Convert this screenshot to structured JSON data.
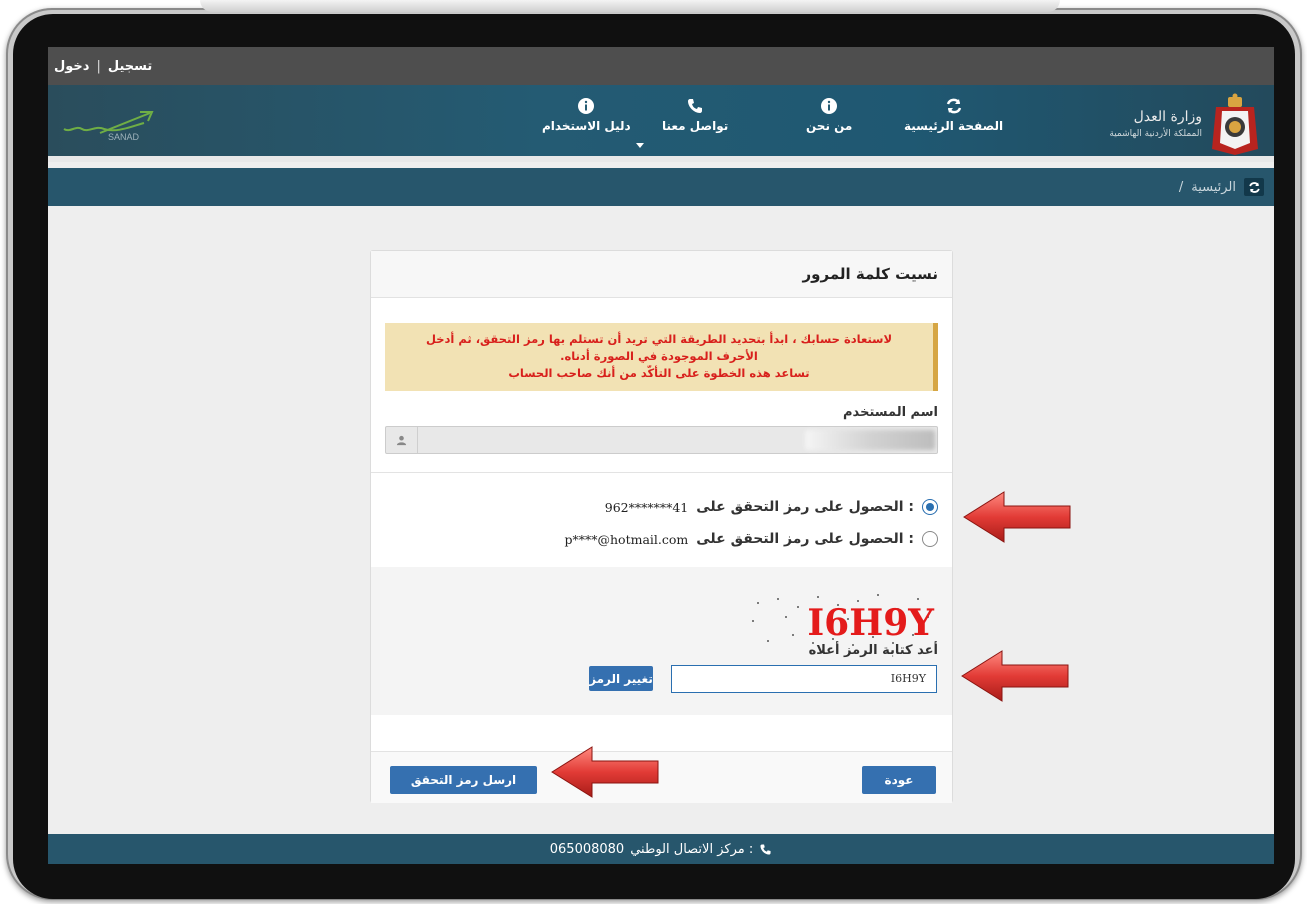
{
  "topbar": {
    "login": "دخول",
    "separator": "|",
    "register": "تسجيل"
  },
  "header": {
    "logo_text": "SANAD",
    "nav": [
      {
        "label": "دليل الاستخدام",
        "icon": "info-icon"
      },
      {
        "label": "تواصل معنا",
        "icon": "phone-icon"
      },
      {
        "label": "من نحن",
        "icon": "info-icon"
      },
      {
        "label": "الصفحة الرئيسية",
        "icon": "refresh-icon"
      }
    ],
    "ministry_name": "وزارة العدل",
    "ministry_sub": "المملكة الأردنية الهاشمية"
  },
  "breadcrumb": {
    "home": "الرئيسية",
    "separator": "/"
  },
  "card": {
    "title": "نسيت كلمة المرور",
    "alert_line1": "لاستعادة حسابك ، ابدأ بتحديد الطريقة التي تريد أن تستلم بها رمز التحقق، ثم أدخل",
    "alert_line2": "الأحرف الموجودة في الصورة أدناه.",
    "alert_line3": "تساعد هذه الخطوة على التأكّد من أنك صاحب الحساب",
    "username_label": "اسم المستخدم",
    "option1_label": "الحصول على رمز التحقق على :",
    "option1_value": "962*******41",
    "option2_label": "الحصول على رمز التحقق على :",
    "option2_value": "p****@hotmail.com",
    "captcha_text": "I6H9Y",
    "captcha_label": "أعد كتابة الرمز أعلاه",
    "captcha_value": "I6H9Y",
    "change_code": "تغيير الرمز",
    "back": "عودة",
    "send_code": "ارسل رمز التحقق"
  },
  "footer": {
    "label": "مركز الاتصال الوطني :",
    "number": "065008080"
  },
  "colors": {
    "header": "#245b73",
    "accent": "#3570b0",
    "alert_bg": "#f2e2b4",
    "alert_text": "#d8201c",
    "arrow": "#e23b36"
  }
}
